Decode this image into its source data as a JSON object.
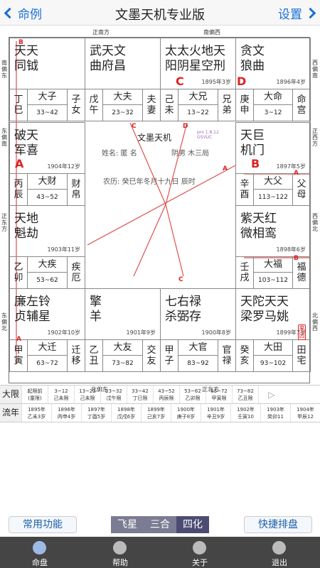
{
  "topbar": {
    "back_label": "命例",
    "title": "文墨天机专业版",
    "settings_label": "设置"
  },
  "directions": {
    "top_south": "正南方",
    "top_southwest": "南偏西",
    "left_south_east": "南偏东",
    "left_east_south": "东偏南",
    "left_east": "正东方",
    "left_east_north": "东偏北",
    "right_west_south": "西偏南",
    "right_south_west": "正西方",
    "right_west_north": "西偏北",
    "right_north_west": "北偏西",
    "bottom_north_east": "北偏东",
    "bottom_north": "正北方"
  },
  "palaces": [
    {
      "stars": "天天\n同钺",
      "age": "",
      "ganzhi": "丁\n巳",
      "name": "大子",
      "range": "33~42",
      "name2": "子\n女"
    },
    {
      "stars": "武天文\n曲府昌",
      "age": "",
      "ganzhi": "戊\n午",
      "name": "大夫",
      "range": "23~32",
      "name2": "夫\n妻"
    },
    {
      "stars": "太太火地天\n阳阴星空刑",
      "age": "1895年3岁",
      "ganzhi": "己\n未",
      "name": "大兄",
      "range": "13~22",
      "name2": "兄\n弟"
    },
    {
      "stars": "贪文\n狼曲",
      "age": "1896年4岁",
      "ganzhi": "庚\n申",
      "name": "大命",
      "range": "3~12",
      "name2": "命\n宫"
    },
    {
      "stars": "破天\n军喜",
      "age": "1904年12岁",
      "ganzhi": "丙\n辰",
      "name": "大财",
      "range": "43~52",
      "name2": "财\n帛"
    },
    {
      "stars": "天巨\n机门",
      "age": "1897年5岁",
      "ganzhi": "辛\n酉",
      "name": "大父",
      "range": "113~122",
      "name2": "父\n母"
    },
    {
      "stars": "天地\n魁劫",
      "age": "1903年11岁",
      "ganzhi": "乙\n卯",
      "name": "大疾",
      "range": "53~62",
      "name2": "疾\n厄"
    },
    {
      "stars": "紫天红\n微相鸾",
      "age": "1898年6岁",
      "ganzhi": "壬\n戌",
      "name": "大福",
      "range": "103~112",
      "name2": "福\n德"
    },
    {
      "stars": "廉左铃\n贞辅星",
      "age": "1902年10岁",
      "ganzhi": "甲\n寅",
      "name": "大迁",
      "range": "63~72",
      "name2": "迁\n移"
    },
    {
      "stars": "擎\n羊",
      "age": "1901年9岁",
      "ganzhi": "乙\n丑",
      "name": "大友",
      "range": "73~82",
      "name2": "交\n友"
    },
    {
      "stars": "七右禄\n杀弼存",
      "age": "1900年8岁",
      "ganzhi": "甲\n子",
      "name": "大官",
      "range": "83~92",
      "name2": "官\n禄"
    },
    {
      "stars": "天陀天天\n梁罗马姚",
      "age": "1899年7岁",
      "ganzhi": "癸\n亥",
      "name": "大田",
      "range": "93~102",
      "name2": "田\n宅"
    }
  ],
  "center": {
    "title": "文墨天机",
    "version": "pro 1.8.12\nGSVUC",
    "name": "姓名: 匿 名",
    "gender": "阴男 木三局",
    "lunar": "农历: 癸巳年冬月十九日 辰时"
  },
  "markers": {
    "A": "A",
    "B": "B",
    "C": "C",
    "D": "D",
    "stamp": "来因"
  },
  "daxian": {
    "label": "大限",
    "cells": [
      "起限前\n(童限)",
      "3~12\n己未限",
      "13~22\n己未限",
      "23~32\n戊午限",
      "33~42\n丁巳限",
      "43~52\n丙辰限",
      "53~62\n乙卯限",
      "63~72\n甲寅限",
      "73~82\n乙丑限"
    ],
    "arrow": "▷"
  },
  "liunian": {
    "label": "流年",
    "cells": [
      "1895年\n乙未3岁",
      "1896年\n丙申4岁",
      "1897年\n丁酉5岁",
      "1898年\n戊戌6岁",
      "1899年\n己亥7岁",
      "1900年\n庚子8岁",
      "1901年\n辛丑9岁",
      "1902年\n壬寅10",
      "1903年\n癸卯11",
      "1904年\n甲辰12"
    ]
  },
  "bottom": {
    "common": "常用功能",
    "seg": [
      "飞星",
      "三合",
      "四化"
    ],
    "quick": "快捷排盘"
  },
  "tabs": [
    {
      "label": "命盘",
      "icon": "chart-icon"
    },
    {
      "label": "帮助",
      "icon": "help-icon"
    },
    {
      "label": "关于",
      "icon": "info-icon"
    },
    {
      "label": "退出",
      "icon": "exit-icon"
    }
  ],
  "colors": {
    "accent": "#1a6fd6",
    "red": "#dd2222",
    "segment_active": "#4b4b73"
  }
}
